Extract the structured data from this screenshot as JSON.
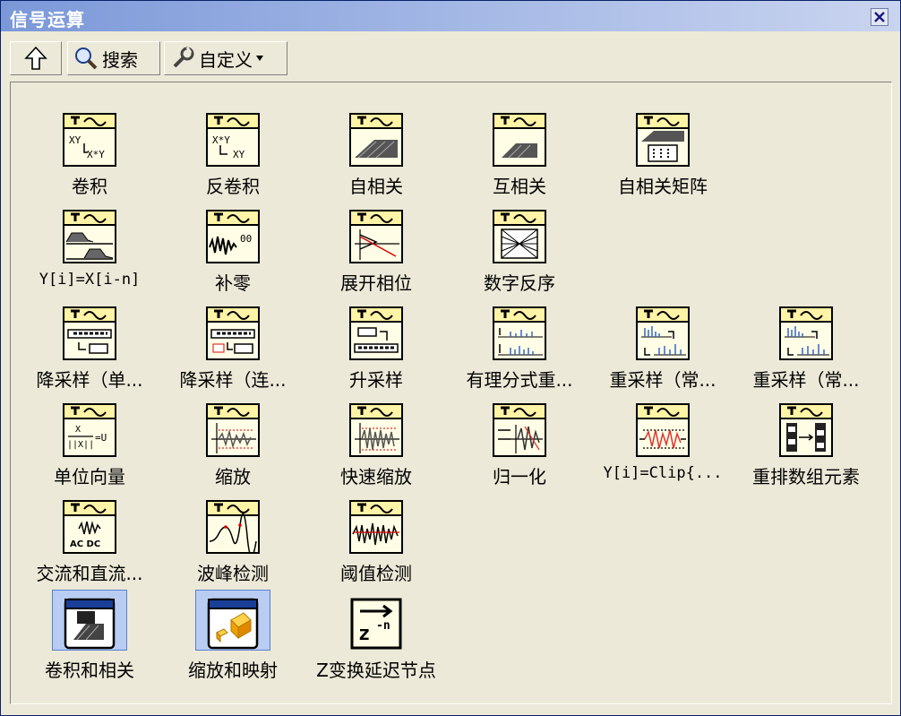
{
  "window": {
    "title": "信号运算"
  },
  "toolbar": {
    "up_label": "",
    "search_label": "搜索",
    "customize_label": "自定义"
  },
  "items": [
    {
      "label": "卷积",
      "icon": "convolution-icon"
    },
    {
      "label": "反卷积",
      "icon": "deconvolution-icon"
    },
    {
      "label": "自相关",
      "icon": "autocorrelation-icon"
    },
    {
      "label": "互相关",
      "icon": "cross-correlation-icon"
    },
    {
      "label": "自相关矩阵",
      "icon": "autocorrelation-matrix-icon"
    },
    {
      "label": "Y[i]=X[i-n]",
      "icon": "shift-icon"
    },
    {
      "label": "补零",
      "icon": "zero-padder-icon"
    },
    {
      "label": "展开相位",
      "icon": "unwrap-phase-icon"
    },
    {
      "label": "数字反序",
      "icon": "digit-reverse-icon"
    },
    {
      "label": "降采样（单...",
      "icon": "decimate-single-icon"
    },
    {
      "label": "降采样（连...",
      "icon": "decimate-continuous-icon"
    },
    {
      "label": "升采样",
      "icon": "upsample-icon"
    },
    {
      "label": "有理分式重...",
      "icon": "rational-resample-icon"
    },
    {
      "label": "重采样（常...",
      "icon": "resample-constant-1-icon"
    },
    {
      "label": "重采样（常...",
      "icon": "resample-constant-2-icon"
    },
    {
      "label": "单位向量",
      "icon": "unit-vector-icon"
    },
    {
      "label": "缩放",
      "icon": "scale-icon"
    },
    {
      "label": "快速缩放",
      "icon": "quick-scale-icon"
    },
    {
      "label": "归一化",
      "icon": "normalize-icon"
    },
    {
      "label": "Y[i]=Clip{...",
      "icon": "clip-icon"
    },
    {
      "label": "重排数组元素",
      "icon": "reorder-array-icon"
    },
    {
      "label": "交流和直流...",
      "icon": "ac-dc-icon"
    },
    {
      "label": "波峰检测",
      "icon": "peak-detector-icon"
    },
    {
      "label": "阈值检测",
      "icon": "threshold-detector-icon"
    },
    {
      "label": "卷积和相关",
      "icon": "convolution-folder-icon"
    },
    {
      "label": "缩放和映射",
      "icon": "scaling-mapping-folder-icon"
    },
    {
      "label": "Z变换延迟节点",
      "icon": "z-transform-delay-icon"
    }
  ],
  "glyphs": {
    "conv_a": "XY",
    "conv_b": "X*Y",
    "deconv_a": "X*Y",
    "deconv_b": "XY",
    "pad": "00",
    "unit_num": "X",
    "unit_den": "||X||",
    "unit_res": "=U",
    "acdc": "AC DC",
    "zexp": "-n",
    "zbase": "z"
  },
  "colors": {
    "titlebar": "#7b98d8",
    "window_bg": "#ece9d8",
    "folder_highlight": "#b8cdf1"
  }
}
